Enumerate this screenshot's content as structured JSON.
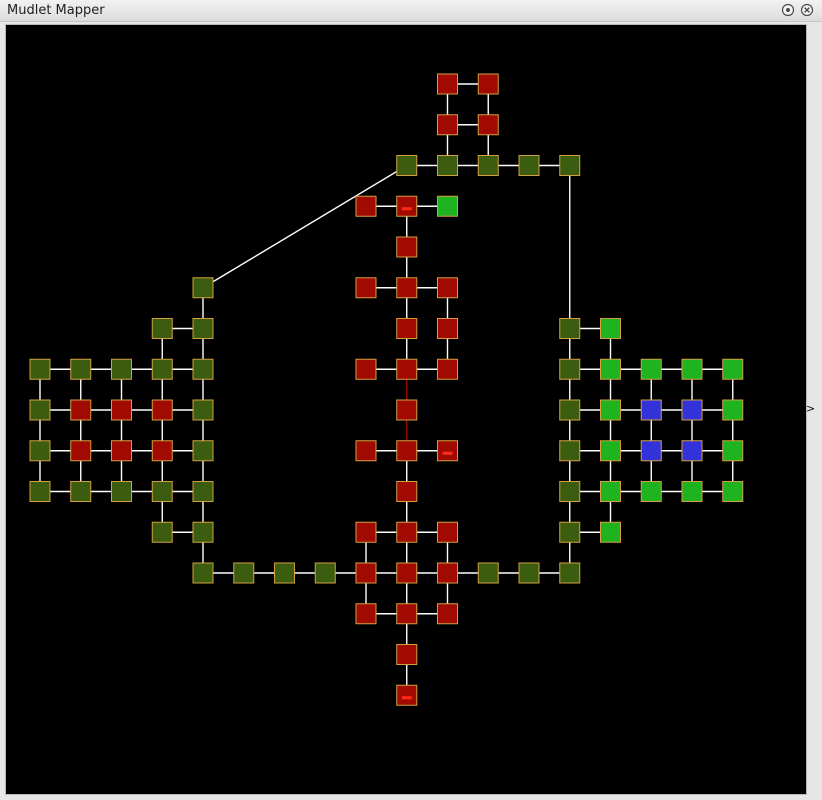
{
  "window": {
    "title": "Mudlet Mapper",
    "float_button_icon": "float-icon",
    "close_button_icon": "close-icon"
  },
  "map": {
    "background": "#000000",
    "link_color": "#ffffff",
    "room_border_color": "#d2a040",
    "room_colors": {
      "olive": "#3c5d10",
      "red": "#a00a00",
      "green": "#1fb41f",
      "blue": "#3232d8"
    },
    "exit_indicator": ">"
  }
}
